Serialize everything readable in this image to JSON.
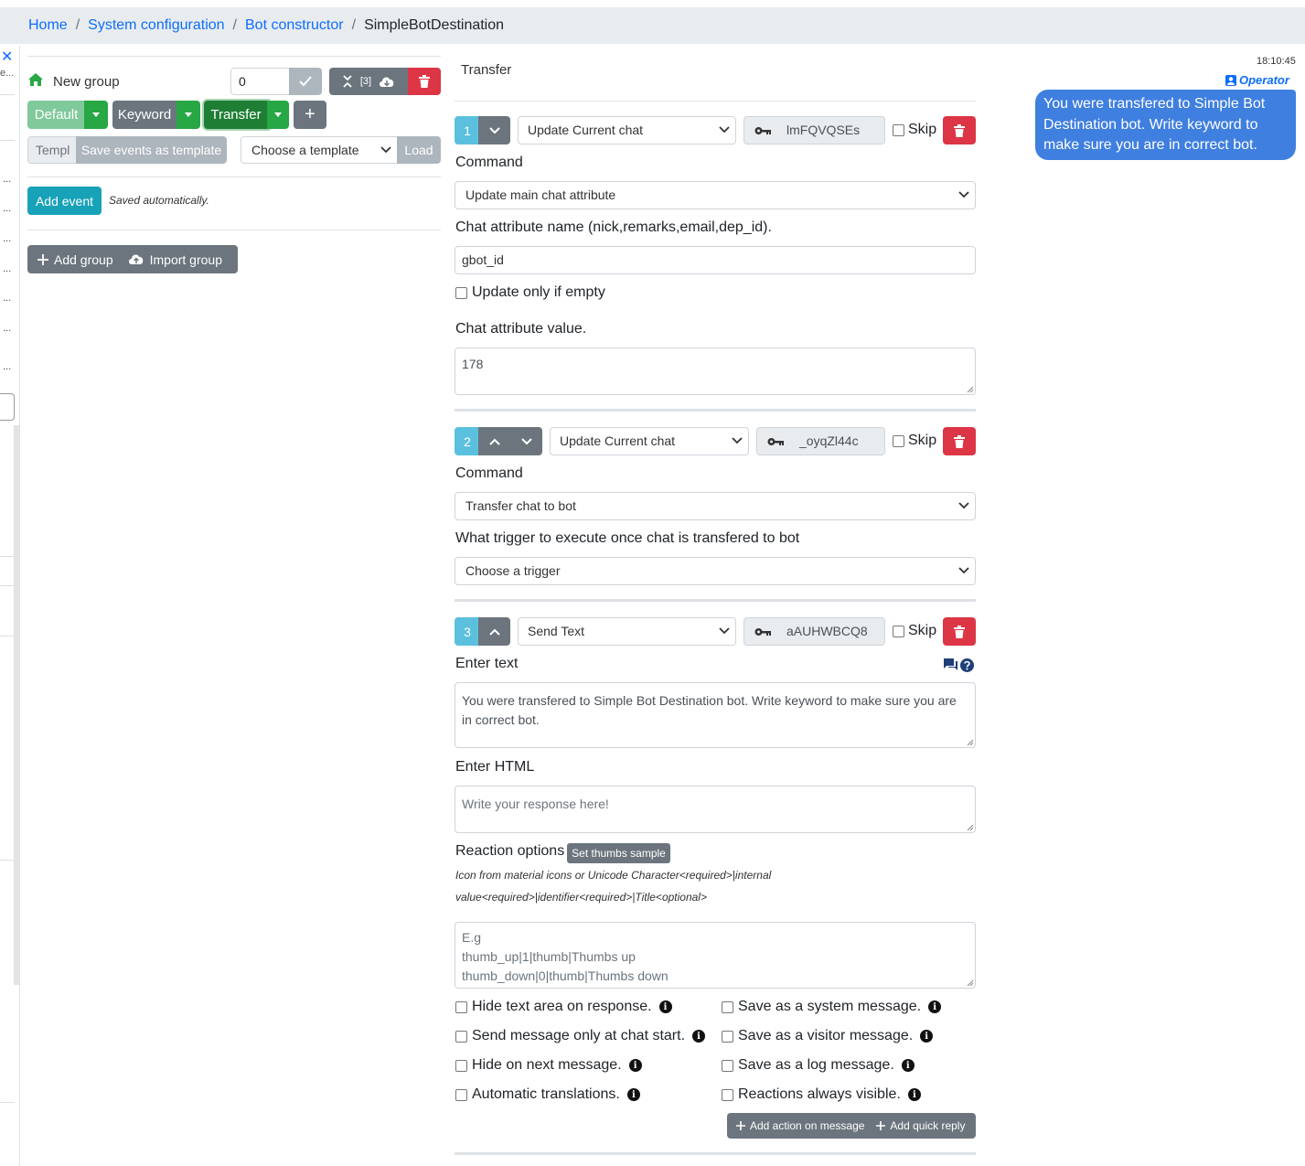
{
  "breadcrumb": {
    "items": [
      "Home",
      "System configuration",
      "Bot constructor"
    ],
    "current": "SimpleBotDestination",
    "separator": "/"
  },
  "left_sidebar": {
    "close": "✕",
    "truncated": "e...",
    "dots": "..."
  },
  "group_editor": {
    "group_name": "New group",
    "position_value": "0",
    "tools_count": "[3]",
    "tabs": [
      "Default",
      "Keyword",
      "Transfer"
    ],
    "active_tab": "Transfer",
    "add_tab": "+",
    "template_name_placeholder": "Templ",
    "save_template_label": "Save events as template",
    "template_select": "Choose a template",
    "load_label": "Load",
    "add_event_label": "Add event",
    "saved_note": "Saved automatically.",
    "add_group_label": "Add group",
    "import_group_label": "Import group"
  },
  "trigger": {
    "title": "Transfer",
    "actions": [
      {
        "number": "1",
        "type": "Update Current chat",
        "id": "lmFQVQSEs",
        "skip_label": "Skip",
        "command_label": "Command",
        "command_value": "Update main chat attribute",
        "attr_name_label": "Chat attribute name (nick,remarks,email,dep_id).",
        "attr_name_value": "gbot_id",
        "update_empty_label": "Update only if empty",
        "attr_value_label": "Chat attribute value.",
        "attr_value": "178"
      },
      {
        "number": "2",
        "type": "Update Current chat",
        "id": "_oyqZl44c",
        "skip_label": "Skip",
        "command_label": "Command",
        "command_value": "Transfer chat to bot",
        "trigger_label": "What trigger to execute once chat is transfered to bot",
        "trigger_value": "Choose a trigger"
      },
      {
        "number": "3",
        "type": "Send Text",
        "id": "aAUHWBCQ8",
        "skip_label": "Skip",
        "text_label": "Enter text",
        "text_value": "You were transfered to Simple Bot Destination bot. Write keyword to make sure you are in correct bot.",
        "html_label": "Enter HTML",
        "html_placeholder": "Write your response here!",
        "reaction_label": "Reaction options",
        "thumbs_button": "Set thumbs sample",
        "reaction_hint_1": "Icon from material icons or Unicode Character<required>|internal",
        "reaction_hint_2": "value<required>|identifier<required>|Title<optional>",
        "reaction_placeholder": [
          "E.g",
          "thumb_up|1|thumb|Thumbs up",
          "thumb_down|0|thumb|Thumbs down"
        ],
        "options_left": [
          "Hide text area on response.",
          "Send message only at chat start.",
          "Hide on next message.",
          "Automatic translations."
        ],
        "options_right": [
          "Save as a system message.",
          "Save as a visitor message.",
          "Save as a log message.",
          "Reactions always visible."
        ],
        "add_action_label": "Add action on message",
        "add_quick_reply_label": "Add quick reply"
      }
    ]
  },
  "preview": {
    "time": "18:10:45",
    "author": "Operator",
    "message": "You were transfered to Simple Bot Destination bot. Write keyword to make sure you are in correct bot."
  },
  "colors": {
    "primary": "#0d6efd",
    "success": "#28a745",
    "danger": "#dc3545",
    "info": "#17a2b8",
    "secondary": "#6c757d",
    "bubble": "#3f7fe0"
  }
}
